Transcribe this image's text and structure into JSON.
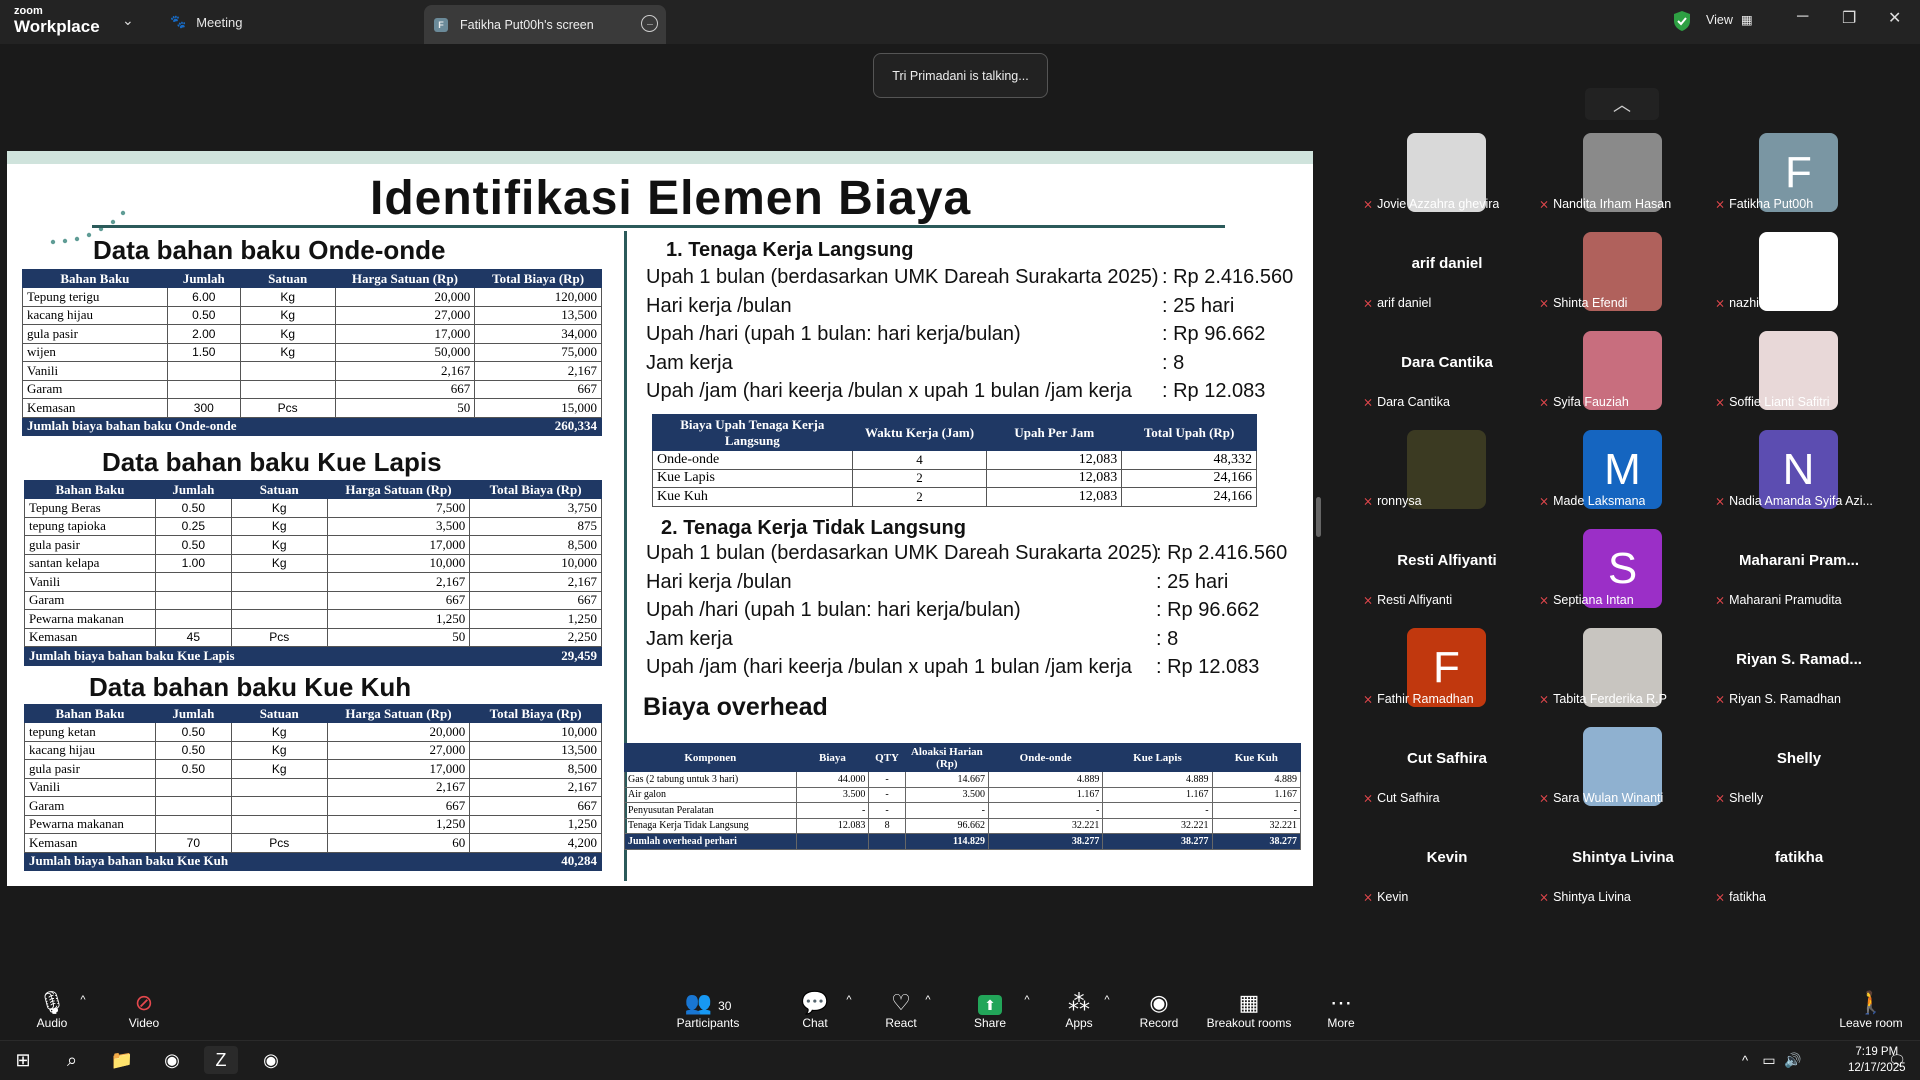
{
  "app": {
    "logo_top": "zoom",
    "logo_bottom": "Workplace"
  },
  "tabs": {
    "meeting": "Meeting",
    "share_initial": "F",
    "share": "Fatikha Put00h's screen"
  },
  "view_label": "View",
  "talking": "Tri Primadani is talking...",
  "slide": {
    "title": "Identifikasi Elemen Biaya",
    "headers": [
      "Bahan Baku",
      "Jumlah",
      "Satuan",
      "Harga Satuan (Rp)",
      "Total Biaya (Rp)"
    ],
    "onde": {
      "title": "Data bahan baku Onde-onde",
      "rows": [
        [
          "Tepung terigu",
          "6.00",
          "Kg",
          "20,000",
          "120,000"
        ],
        [
          "kacang hijau",
          "0.50",
          "Kg",
          "27,000",
          "13,500"
        ],
        [
          "gula pasir",
          "2.00",
          "Kg",
          "17,000",
          "34,000"
        ],
        [
          "wijen",
          "1.50",
          "Kg",
          "50,000",
          "75,000"
        ],
        [
          "Vanili",
          "",
          "",
          "2,167",
          "2,167"
        ],
        [
          "Garam",
          "",
          "",
          "667",
          "667"
        ],
        [
          "Kemasan",
          "300",
          "Pcs",
          "50",
          "15,000"
        ]
      ],
      "total_label": "Jumlah biaya bahan baku Onde-onde",
      "total": "260,334"
    },
    "lapis": {
      "title": "Data bahan baku Kue Lapis",
      "rows": [
        [
          "Tepung Beras",
          "0.50",
          "Kg",
          "7,500",
          "3,750"
        ],
        [
          "tepung tapioka",
          "0.25",
          "Kg",
          "3,500",
          "875"
        ],
        [
          "gula pasir",
          "0.50",
          "Kg",
          "17,000",
          "8,500"
        ],
        [
          "santan kelapa",
          "1.00",
          "Kg",
          "10,000",
          "10,000"
        ],
        [
          "Vanili",
          "",
          "",
          "2,167",
          "2,167"
        ],
        [
          "Garam",
          "",
          "",
          "667",
          "667"
        ],
        [
          "Pewarna makanan",
          "",
          "",
          "1,250",
          "1,250"
        ],
        [
          "Kemasan",
          "45",
          "Pcs",
          "50",
          "2,250"
        ]
      ],
      "total_label": "Jumlah biaya bahan baku Kue Lapis",
      "total": "29,459"
    },
    "kuh": {
      "title": "Data bahan baku Kue Kuh",
      "rows": [
        [
          "tepung ketan",
          "0.50",
          "Kg",
          "20,000",
          "10,000"
        ],
        [
          "kacang hijau",
          "0.50",
          "Kg",
          "27,000",
          "13,500"
        ],
        [
          "gula pasir",
          "0.50",
          "Kg",
          "17,000",
          "8,500"
        ],
        [
          "Vanili",
          "",
          "",
          "2,167",
          "2,167"
        ],
        [
          "Garam",
          "",
          "",
          "667",
          "667"
        ],
        [
          "Pewarna makanan",
          "",
          "",
          "1,250",
          "1,250"
        ],
        [
          "Kemasan",
          "70",
          "Pcs",
          "60",
          "4,200"
        ]
      ],
      "total_label": "Jumlah biaya bahan baku Kue Kuh",
      "total": "40,284"
    },
    "tkl": {
      "num": "1.",
      "title": "Tenaga Kerja Langsung",
      "lines": [
        [
          "Upah 1 bulan (berdasarkan UMK Dareah Surakarta 2025)",
          ": Rp 2.416.560"
        ],
        [
          "Hari kerja /bulan",
          ": 25 hari"
        ],
        [
          "Upah /hari (upah 1 bulan: hari kerja/bulan)",
          ": Rp 96.662"
        ],
        [
          "Jam kerja",
          ": 8"
        ],
        [
          "Upah /jam (hari keerja /bulan x upah 1 bulan /jam kerja",
          ": Rp 12.083"
        ]
      ]
    },
    "upah_table": {
      "headers": [
        "Biaya Upah Tenaga Kerja Langsung",
        "Waktu Kerja (Jam)",
        "Upah Per Jam",
        "Total Upah (Rp)"
      ],
      "rows": [
        [
          "Onde-onde",
          "4",
          "12,083",
          "48,332"
        ],
        [
          "Kue Lapis",
          "2",
          "12,083",
          "24,166"
        ],
        [
          "Kue Kuh",
          "2",
          "12,083",
          "24,166"
        ]
      ]
    },
    "tktl": {
      "num": "2.",
      "title": "Tenaga Kerja Tidak Langsung",
      "lines": [
        [
          "Upah 1 bulan (berdasarkan UMK Dareah Surakarta 2025)",
          ": Rp 2.416.560"
        ],
        [
          "Hari kerja /bulan",
          ": 25 hari"
        ],
        [
          "Upah /hari (upah 1 bulan: hari kerja/bulan)",
          ": Rp 96.662"
        ],
        [
          "Jam kerja",
          ": 8"
        ],
        [
          "Upah /jam (hari keerja /bulan x upah 1 bulan /jam kerja",
          ": Rp 12.083"
        ]
      ]
    },
    "overhead": {
      "title": "Biaya overhead",
      "headers": [
        "Komponen",
        "Biaya",
        "QTY",
        "Aloaksi Harian (Rp)",
        "Onde-onde",
        "Kue Lapis",
        "Kue Kuh"
      ],
      "rows": [
        [
          "Gas (2 tabung untuk 3 hari)",
          "44.000",
          "-",
          "14.667",
          "4.889",
          "4.889",
          "4.889"
        ],
        [
          "Air galon",
          "3.500",
          "-",
          "3.500",
          "1.167",
          "1.167",
          "1.167"
        ],
        [
          "Penyusutan Peralatan",
          "-",
          "-",
          "-",
          "-",
          "-",
          "-"
        ],
        [
          "Tenaga Kerja Tidak Langsung",
          "12.083",
          "8",
          "96.662",
          "32.221",
          "32.221",
          "32.221"
        ]
      ],
      "total": [
        "Jumlah overhead perhari",
        "",
        "",
        "114.829",
        "38.277",
        "38.277",
        "38.277"
      ]
    }
  },
  "participants": [
    {
      "name": "Jovie Azzahra ghevira",
      "type": "photo",
      "color": "#d9d9d9"
    },
    {
      "name": "Nandita Irham Hasan",
      "type": "photo",
      "color": "#8a8a8a"
    },
    {
      "name": "Fatikha Put00h",
      "type": "letter",
      "letter": "F",
      "color": "#7a96a3"
    },
    {
      "name": "arif daniel",
      "type": "name"
    },
    {
      "name": "Shinta Efendi",
      "type": "photo",
      "color": "#b0615c"
    },
    {
      "name": "nazhira faiza",
      "type": "photo",
      "color": "#ffffff"
    },
    {
      "name": "Dara Cantika",
      "type": "name"
    },
    {
      "name": "Syifa Fauziah",
      "type": "photo",
      "color": "#c86e7e"
    },
    {
      "name": "Soffie Lianti Safitri",
      "type": "photo",
      "color": "#e8d8d8"
    },
    {
      "name": "ronnysa",
      "type": "photo",
      "color": "#3b3a22"
    },
    {
      "name": "Made Laksmana",
      "type": "letter",
      "letter": "M",
      "color": "#1565c0"
    },
    {
      "name": "Nadia Amanda Syifa Azi...",
      "type": "letter",
      "letter": "N",
      "color": "#5c4db1"
    },
    {
      "name": "Resti Alfiyanti",
      "type": "name"
    },
    {
      "name": "Septiana Intan",
      "type": "letter",
      "letter": "S",
      "color": "#9b2fc7"
    },
    {
      "name": "Maharani Pramudita",
      "type": "name",
      "short": "Maharani  Pram..."
    },
    {
      "name": "Fathir Ramadhan",
      "type": "letter",
      "letter": "F",
      "color": "#c1380e"
    },
    {
      "name": "Tabita Ferderika R.P",
      "type": "photo",
      "color": "#c8c5c0"
    },
    {
      "name": "Riyan S. Ramadhan",
      "type": "name",
      "short": "Riyan S. Ramad..."
    },
    {
      "name": "Cut Safhira",
      "type": "name"
    },
    {
      "name": "Sara Wulan Winanti",
      "type": "photo",
      "color": "#8fb1d0"
    },
    {
      "name": "Shelly",
      "type": "name"
    },
    {
      "name": "Kevin",
      "type": "name"
    },
    {
      "name": "Shintya Livina",
      "type": "name"
    },
    {
      "name": "fatikha",
      "type": "name"
    }
  ],
  "toolbar": {
    "audio": "Audio",
    "video": "Video",
    "participants": "Participants",
    "participants_count": "30",
    "chat": "Chat",
    "react": "React",
    "share": "Share",
    "apps": "Apps",
    "record": "Record",
    "breakout": "Breakout rooms",
    "more": "More",
    "leave": "Leave room"
  },
  "clock": {
    "time": "7:19 PM",
    "date": "12/17/2025"
  }
}
